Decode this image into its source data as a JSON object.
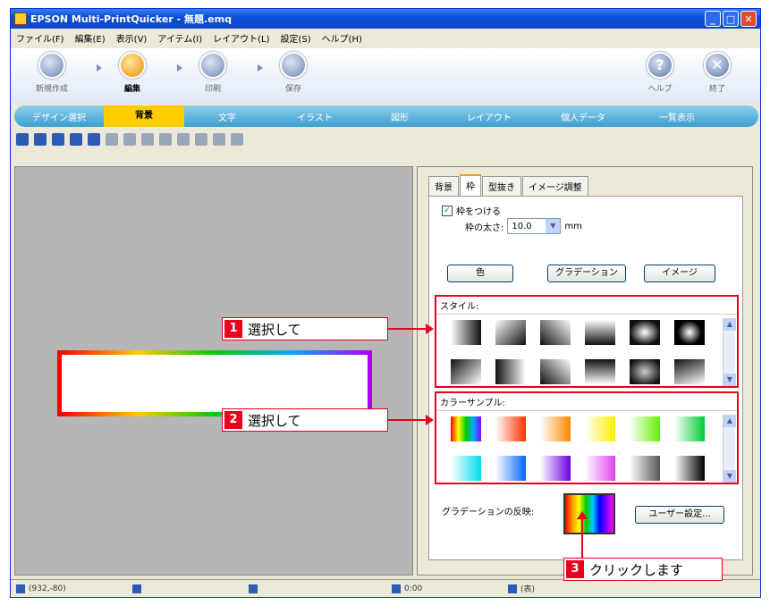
{
  "window": {
    "title": "EPSON Multi-PrintQuicker - 無題.emq",
    "buttons": [
      "_",
      "□",
      "✕"
    ]
  },
  "menu": [
    "ファイル(F)",
    "編集(E)",
    "表示(V)",
    "アイテム(I)",
    "レイアウト(L)",
    "設定(S)",
    "ヘルプ(H)"
  ],
  "main_toolbar": {
    "steps": [
      {
        "label": "新規作成"
      },
      {
        "label": "編集"
      },
      {
        "label": "印刷"
      },
      {
        "label": "保存"
      }
    ],
    "help_label": "ヘルプ",
    "exit_label": "終了",
    "help_glyph": "?",
    "exit_glyph": "✕"
  },
  "tabs": [
    "デザイン選択",
    "背景",
    "文字",
    "イラスト",
    "図形",
    "レイアウト",
    "個人データ",
    "一覧表示"
  ],
  "panel": {
    "tabs": [
      "背景",
      "枠",
      "型抜き",
      "イメージ調整"
    ],
    "checkbox_label": "枠をつける",
    "checkbox_mark": "✓",
    "thickness_label": "枠の太さ:",
    "thickness_value": "10.0",
    "thickness_unit": "mm",
    "buttons": [
      "色",
      "グラデーション",
      "イメージ"
    ],
    "style_label": "スタイル:",
    "color_label": "カラーサンプル:",
    "grad_label": "グラデーションの反映:",
    "user_button": "ユーザー設定..."
  },
  "callouts": [
    {
      "num": "1",
      "text": "選択して"
    },
    {
      "num": "2",
      "text": "選択して"
    },
    {
      "num": "3",
      "text": "クリックします"
    }
  ],
  "status": {
    "pos": "(932,-80)",
    "zoom": "0:00",
    "mode": "(表)"
  },
  "colors": {
    "accent": "#ffcc00",
    "callout_red": "#e8001c",
    "title_blue": "#0a4ed6"
  }
}
